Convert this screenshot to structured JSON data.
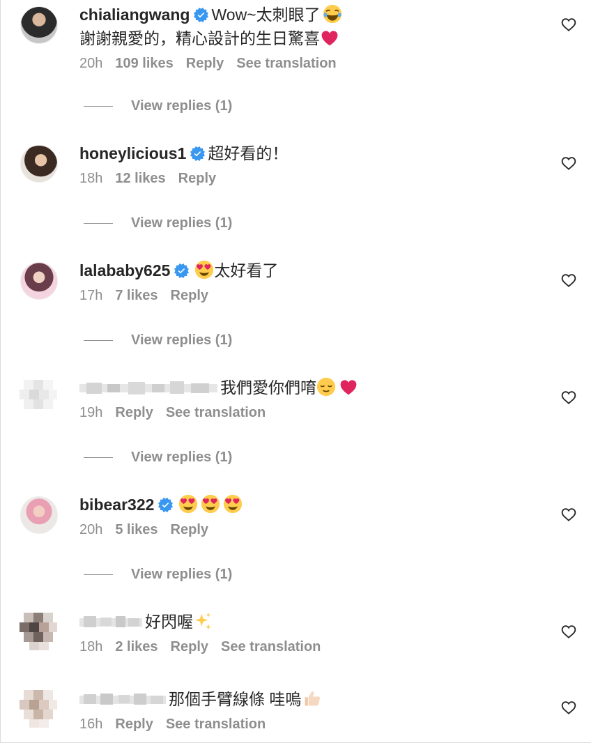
{
  "comments": [
    {
      "username": "chialiangwang",
      "verified": true,
      "text": "Wow~太刺眼了",
      "text2": "謝謝親愛的，精心設計的生日驚喜",
      "time": "20h",
      "likes": "109 likes",
      "reply": "Reply",
      "translate": "See translation",
      "view_replies": "View replies (1)"
    },
    {
      "username": "honeylicious1",
      "verified": true,
      "text": "超好看的！",
      "time": "18h",
      "likes": "12 likes",
      "reply": "Reply",
      "view_replies": "View replies (1)"
    },
    {
      "username": "lalababy625",
      "verified": true,
      "text": "太好看了",
      "time": "17h",
      "likes": "7 likes",
      "reply": "Reply",
      "view_replies": "View replies (1)"
    },
    {
      "username_blurred": true,
      "text": "我們愛你們唷",
      "time": "19h",
      "reply": "Reply",
      "translate": "See translation",
      "view_replies": "View replies (1)"
    },
    {
      "username": "bibear322",
      "verified": true,
      "time": "20h",
      "likes": "5 likes",
      "reply": "Reply",
      "view_replies": "View replies (1)"
    },
    {
      "username_blurred": true,
      "text": "好閃喔",
      "time": "18h",
      "likes": "2 likes",
      "reply": "Reply",
      "translate": "See translation"
    },
    {
      "username_blurred": true,
      "text": "那個手臂線條 哇嗚",
      "time": "16h",
      "reply": "Reply",
      "translate": "See translation"
    }
  ],
  "icons": {
    "heart": "heart-outline-icon",
    "verified": "verified-badge-icon"
  },
  "colors": {
    "verified": "#3897f0",
    "muted": "#8e8e8e",
    "text": "#262626"
  }
}
